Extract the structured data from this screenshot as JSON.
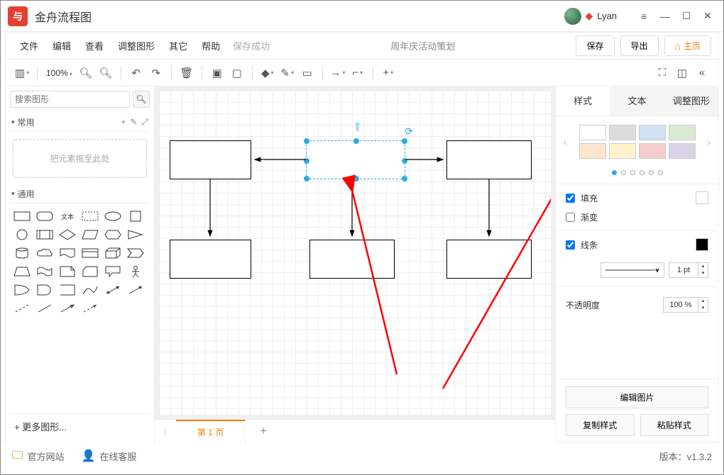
{
  "app": {
    "title": "金舟流程图",
    "username": "Lyan"
  },
  "menu": {
    "file": "文件",
    "edit": "编辑",
    "view": "查看",
    "adjust": "调整图形",
    "other": "其它",
    "help": "帮助",
    "saveStatus": "保存成功"
  },
  "doc": {
    "title": "周年庆活动策划"
  },
  "buttons": {
    "save": "保存",
    "export": "导出",
    "home": "主页"
  },
  "zoom": "100%",
  "leftPanel": {
    "searchPlaceholder": "搜索图形",
    "sections": {
      "common": "常用",
      "general": "通用"
    },
    "dragHint": "把元素拖至此处",
    "moreShapes": "更多图形..."
  },
  "tabs": {
    "page1": "第 1 页"
  },
  "rightPanel": {
    "tabs": {
      "style": "样式",
      "text": "文本",
      "adjust": "调整图形"
    },
    "swatches": [
      "#ffffff",
      "#dcdcdc",
      "#cfe2f3",
      "#d9ead3",
      "#fce5cd",
      "#fff2cc",
      "#f4cccc",
      "#d9d2e9"
    ],
    "fill": "填充",
    "gradient": "渐变",
    "line": "线条",
    "lineWidth": "1 pt",
    "opacity": "不透明度",
    "opacityValue": "100 %",
    "editImage": "编辑图片",
    "copyStyle": "复制样式",
    "pasteStyle": "粘贴样式"
  },
  "statusbar": {
    "official": "官方网站",
    "support": "在线客服",
    "version": "版本：v1.3.2"
  }
}
